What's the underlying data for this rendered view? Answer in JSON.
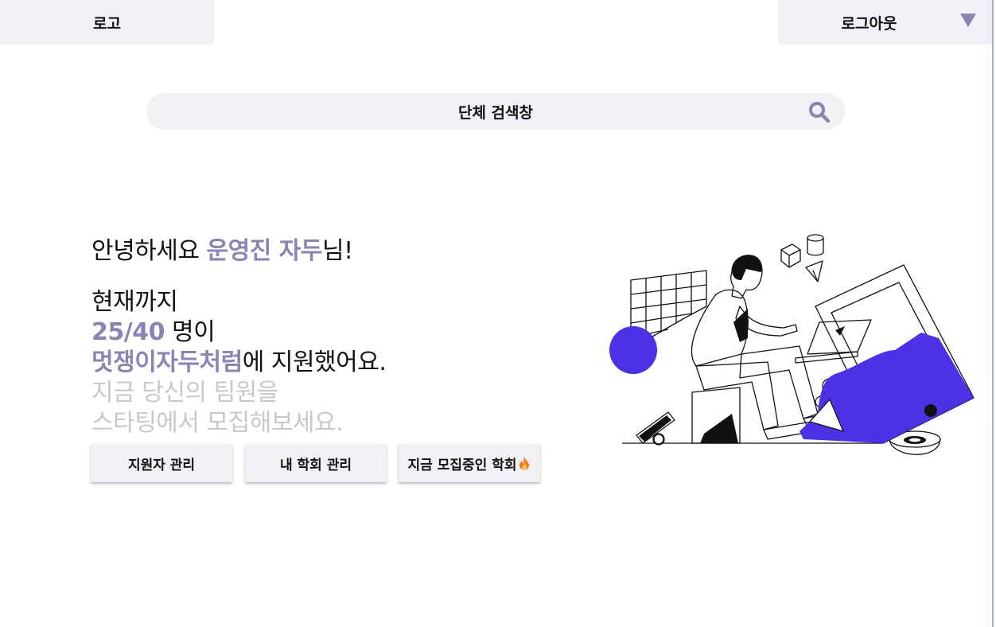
{
  "header": {
    "logo_label": "로고",
    "logout_label": "로그아웃"
  },
  "search": {
    "placeholder": "단체 검색창"
  },
  "greeting": {
    "prefix": "안녕하세요 ",
    "name": "운영진 자두",
    "suffix": "님!"
  },
  "stats": {
    "line1": "현재까지",
    "count": "25/40",
    "count_suffix": " 명이",
    "club": "멋쟁이자두처럼",
    "club_suffix": "에 지원했어요.",
    "cta_line1": "지금 당신의 팀원을",
    "cta_line2": "스타팅에서 모집해보세요."
  },
  "buttons": {
    "applicants": "지원자 관리",
    "my_club": "내 학회 관리",
    "recruiting": "지금 모집중인 학회"
  },
  "icons": {
    "caret": "caret-down-icon",
    "search": "search-icon",
    "fire": "fire-emoji"
  },
  "colors": {
    "accent": "#8a84b3",
    "panel": "#f0f0f5",
    "illustration_accent": "#4b32e6",
    "muted_text": "#c8c8c8"
  }
}
